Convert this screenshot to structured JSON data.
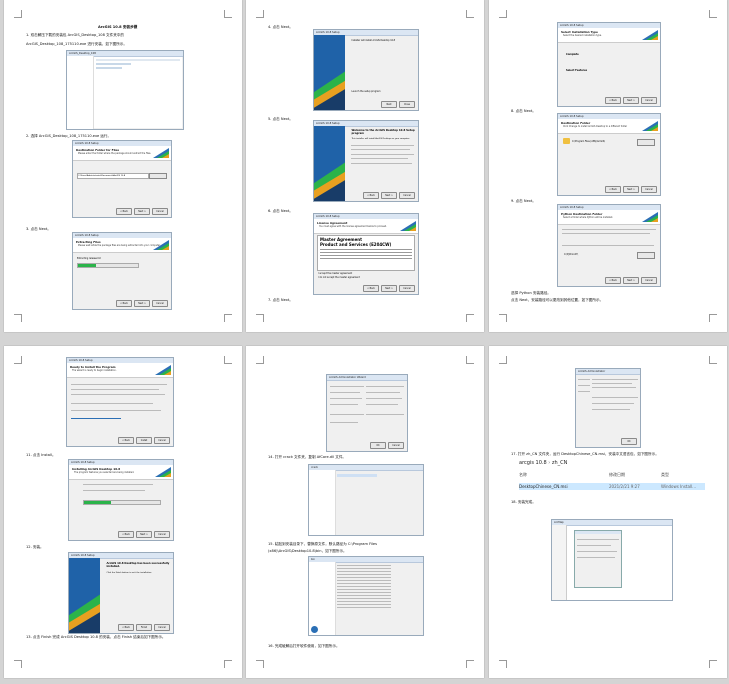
{
  "pages": [
    {
      "texts": [
        {
          "t": "ArcGIS 10.8 安装步骤",
          "b": true
        },
        {
          "t": "1. 双击解压下载的安装包 ArcGIS_Desktop_108 文件夹中的"
        },
        {
          "t": "ArcGIS_Desktop_108_175110.exe 进行安装，如下图所示。"
        },
        {
          "t": "2. 选择 ArcGIS_Desktop_108_175110.exe 运行。"
        },
        {
          "t": "3. 点击 Next。"
        }
      ],
      "shots": [
        {
          "title": "ArcGIS_Desktop_108",
          "header": "",
          "sub": ""
        },
        {
          "title": "ArcGIS 10.8 Setup",
          "header": "Destination Folder for Files",
          "sub": "Please enter the folder where the package should extract the files.",
          "field": "C:\\Users\\Administrator\\Documents\\ArcGIS 10.8"
        },
        {
          "title": "ArcGIS 10.8 Setup",
          "header": "Extracting Files",
          "sub": "Please wait while the package files are being extracted into your computer.",
          "status": "Extracting release.txt",
          "progress": 0.3
        }
      ]
    },
    {
      "texts": [
        {
          "t": "4. 点击 Next。"
        },
        {
          "t": "5. 点击 Next。"
        },
        {
          "t": "6. 点击 Next。"
        },
        {
          "t": "7. 点击 Next。"
        }
      ],
      "shots": [
        {
          "title": "ArcGIS 10.8 Setup",
          "header": "",
          "sub": "Installer will install ArcGIS Desktop 10.8",
          "launch": "Launch the setup program"
        },
        {
          "title": "ArcGIS 10.8 Setup",
          "header": "Welcome to the ArcGIS Desktop 10.8 Setup program",
          "sub": "This installer will install ArcGIS Desktop on your computer."
        },
        {
          "title": "ArcGIS 10.8 Setup",
          "header": "License Agreement",
          "sub": "You must agree with the license agreement below to proceed.",
          "doc1": "Master Agreement",
          "doc2": "Product and Services (E204CW)",
          "accept": "I accept the master agreement",
          "decline": "I do not accept the master agreement"
        }
      ]
    },
    {
      "texts": [
        {
          "t": "8. 点击 Next。"
        },
        {
          "t": "9. 点击 Next。"
        },
        {
          "t": "10. 点击 Next。"
        },
        {
          "t": "选择 Python 安装路径。"
        },
        {
          "t": "点击 Next，安装路径可以更改到其他位置，如下图所示。"
        }
      ],
      "shots": [
        {
          "title": "ArcGIS 10.8 Setup",
          "header": "Select Installation Type",
          "sub": "Select the desired installation type.",
          "opt1": "Complete",
          "opt2": "Select Features"
        },
        {
          "title": "ArcGIS 10.8 Setup",
          "header": "Destination Folder",
          "sub": "Click Change to install ArcGIS Desktop to a different folder",
          "path": "C:\\Program Files (x86)\\ArcGIS\\"
        },
        {
          "title": "ArcGIS 10.8 Setup",
          "header": "Python Destination Folder",
          "sub": "Select a folder where Python will be installed.",
          "path": "C:\\Python27\\"
        }
      ]
    },
    {
      "texts": [
        {
          "t": "11. 点击 Install。"
        },
        {
          "t": "12. 安装。"
        },
        {
          "t": "13. 点击 Finish 完成 ArcGIS Desktop 10.8 的安装，点击 Finish 结束后如下图所示。"
        }
      ],
      "shots": [
        {
          "title": "ArcGIS 10.8 Setup",
          "header": "Ready to Install the Program",
          "sub": "The wizard is ready to begin installation."
        },
        {
          "title": "ArcGIS 10.8 Setup",
          "header": "Installing ArcGIS Desktop 10.8",
          "sub": "The program features you selected are being installed.",
          "progress": 0.35
        },
        {
          "title": "ArcGIS 10.8 Setup",
          "header": "ArcGIS 10.8 Desktop has been successfully installed.",
          "sub": "Click the Finish button to exit the installation."
        }
      ]
    },
    {
      "texts": [
        {
          "t": "14. 打开 crack 文件夹，复制 AfCore.dll 文件。"
        },
        {
          "t": "15. 粘贴到安装目录下，替换原文件，默认路径为 C:\\Program Files"
        },
        {
          "t": "(x86)\\ArcGIS\\Desktop10.8\\bin，如下图所示。"
        },
        {
          "t": "16. 完成破解后打开软件使用，如下图所示。"
        }
      ],
      "shots": [
        {
          "title": "ArcGIS Administrator Wizard",
          "header": "",
          "sub": ""
        },
        {
          "title": "crack",
          "header": "",
          "sub": ""
        },
        {
          "title": "bin",
          "header": "",
          "sub": ""
        }
      ]
    },
    {
      "texts": [
        {
          "t": "17. 打开 zh_CN 文件夹，运行 DesktopChinese_CN.msi，安装中文语言包，如下图所示。"
        },
        {
          "t": "18. 安装完成。"
        }
      ],
      "breadcrumb": [
        "arcgis 10.8",
        "zh_CN"
      ],
      "table": {
        "headers": [
          "名称",
          "修改日期",
          "类型"
        ],
        "row": [
          "DesktopChinese_CN.msi",
          "2021/2/21 9:27",
          "Windows Install..."
        ]
      },
      "shots": [
        {
          "title": "ArcGIS Administrator",
          "header": "",
          "sub": ""
        },
        {
          "title": "ArcMap",
          "header": "",
          "sub": ""
        }
      ]
    }
  ],
  "colors": {
    "accent": "#2b6fb5",
    "green": "#2bb34a",
    "orange": "#e8a020"
  }
}
